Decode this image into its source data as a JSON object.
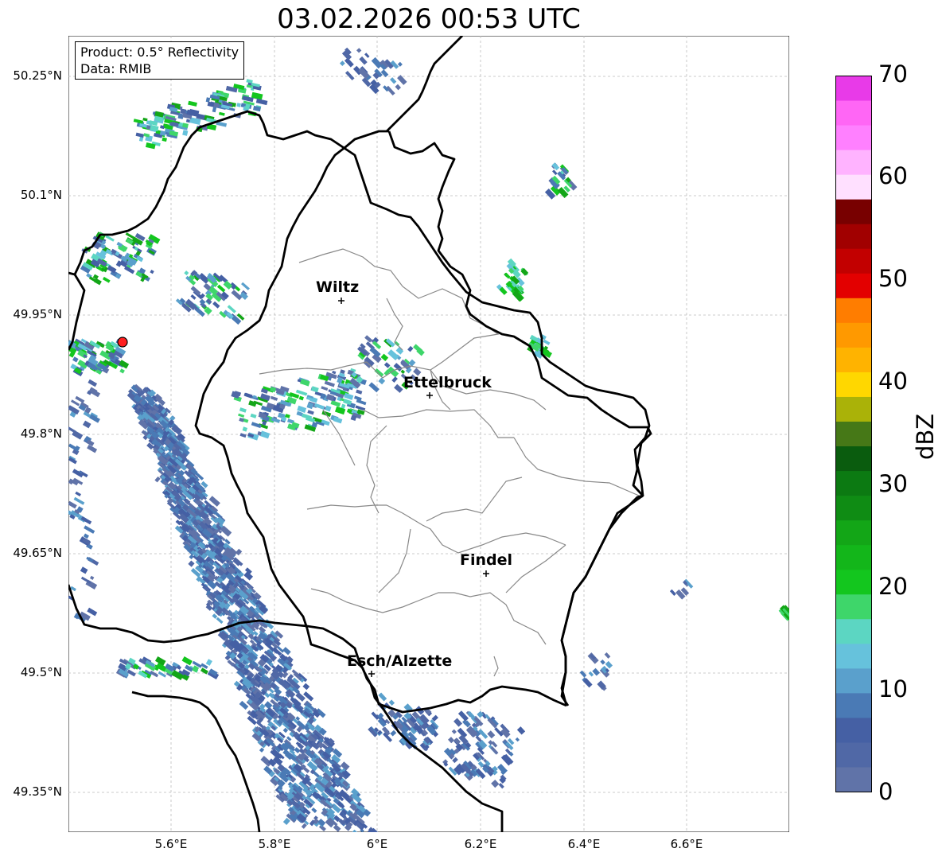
{
  "title": "03.02.2026 00:53 UTC",
  "infobox": {
    "product": "Product: 0.5° Reflectivity",
    "data_source": "Data: RMIB"
  },
  "lat_labels": [
    "50.25°N",
    "50.1°N",
    "49.95°N",
    "49.8°N",
    "49.65°N",
    "49.5°N",
    "49.35°N"
  ],
  "lon_labels": [
    "5.6°E",
    "5.8°E",
    "6°E",
    "6.2°E",
    "6.4°E",
    "6.6°E"
  ],
  "cities": [
    {
      "name": "Wiltz"
    },
    {
      "name": "Ettelbruck"
    },
    {
      "name": "Findel"
    },
    {
      "name": "Esch/Alzette"
    }
  ],
  "colorbar": {
    "label": "dBZ",
    "ticks": [
      "0",
      "10",
      "20",
      "30",
      "40",
      "50",
      "60",
      "70"
    ],
    "range": [
      0,
      70
    ],
    "colors": [
      "#6073a8",
      "#5068a6",
      "#4560a4",
      "#4a7ab5",
      "#5aa0cc",
      "#66c2dc",
      "#5cd6c2",
      "#3ed66a",
      "#13c61e",
      "#13b61a",
      "#13a617",
      "#0f8c14",
      "#0c7a12",
      "#0a5c0e",
      "#467817",
      "#aab208",
      "#ffd700",
      "#ffb300",
      "#ff9900",
      "#ff7d00",
      "#e30000",
      "#c20000",
      "#a10000",
      "#780000",
      "#ffe0ff",
      "#ffb3ff",
      "#ff80ff",
      "#ff66f5",
      "#e83ae8"
    ]
  },
  "colors": {
    "border": "#000000",
    "canton_lines": "#888888",
    "grid": "#bbbbbb",
    "radar_site": "#ff2020"
  }
}
